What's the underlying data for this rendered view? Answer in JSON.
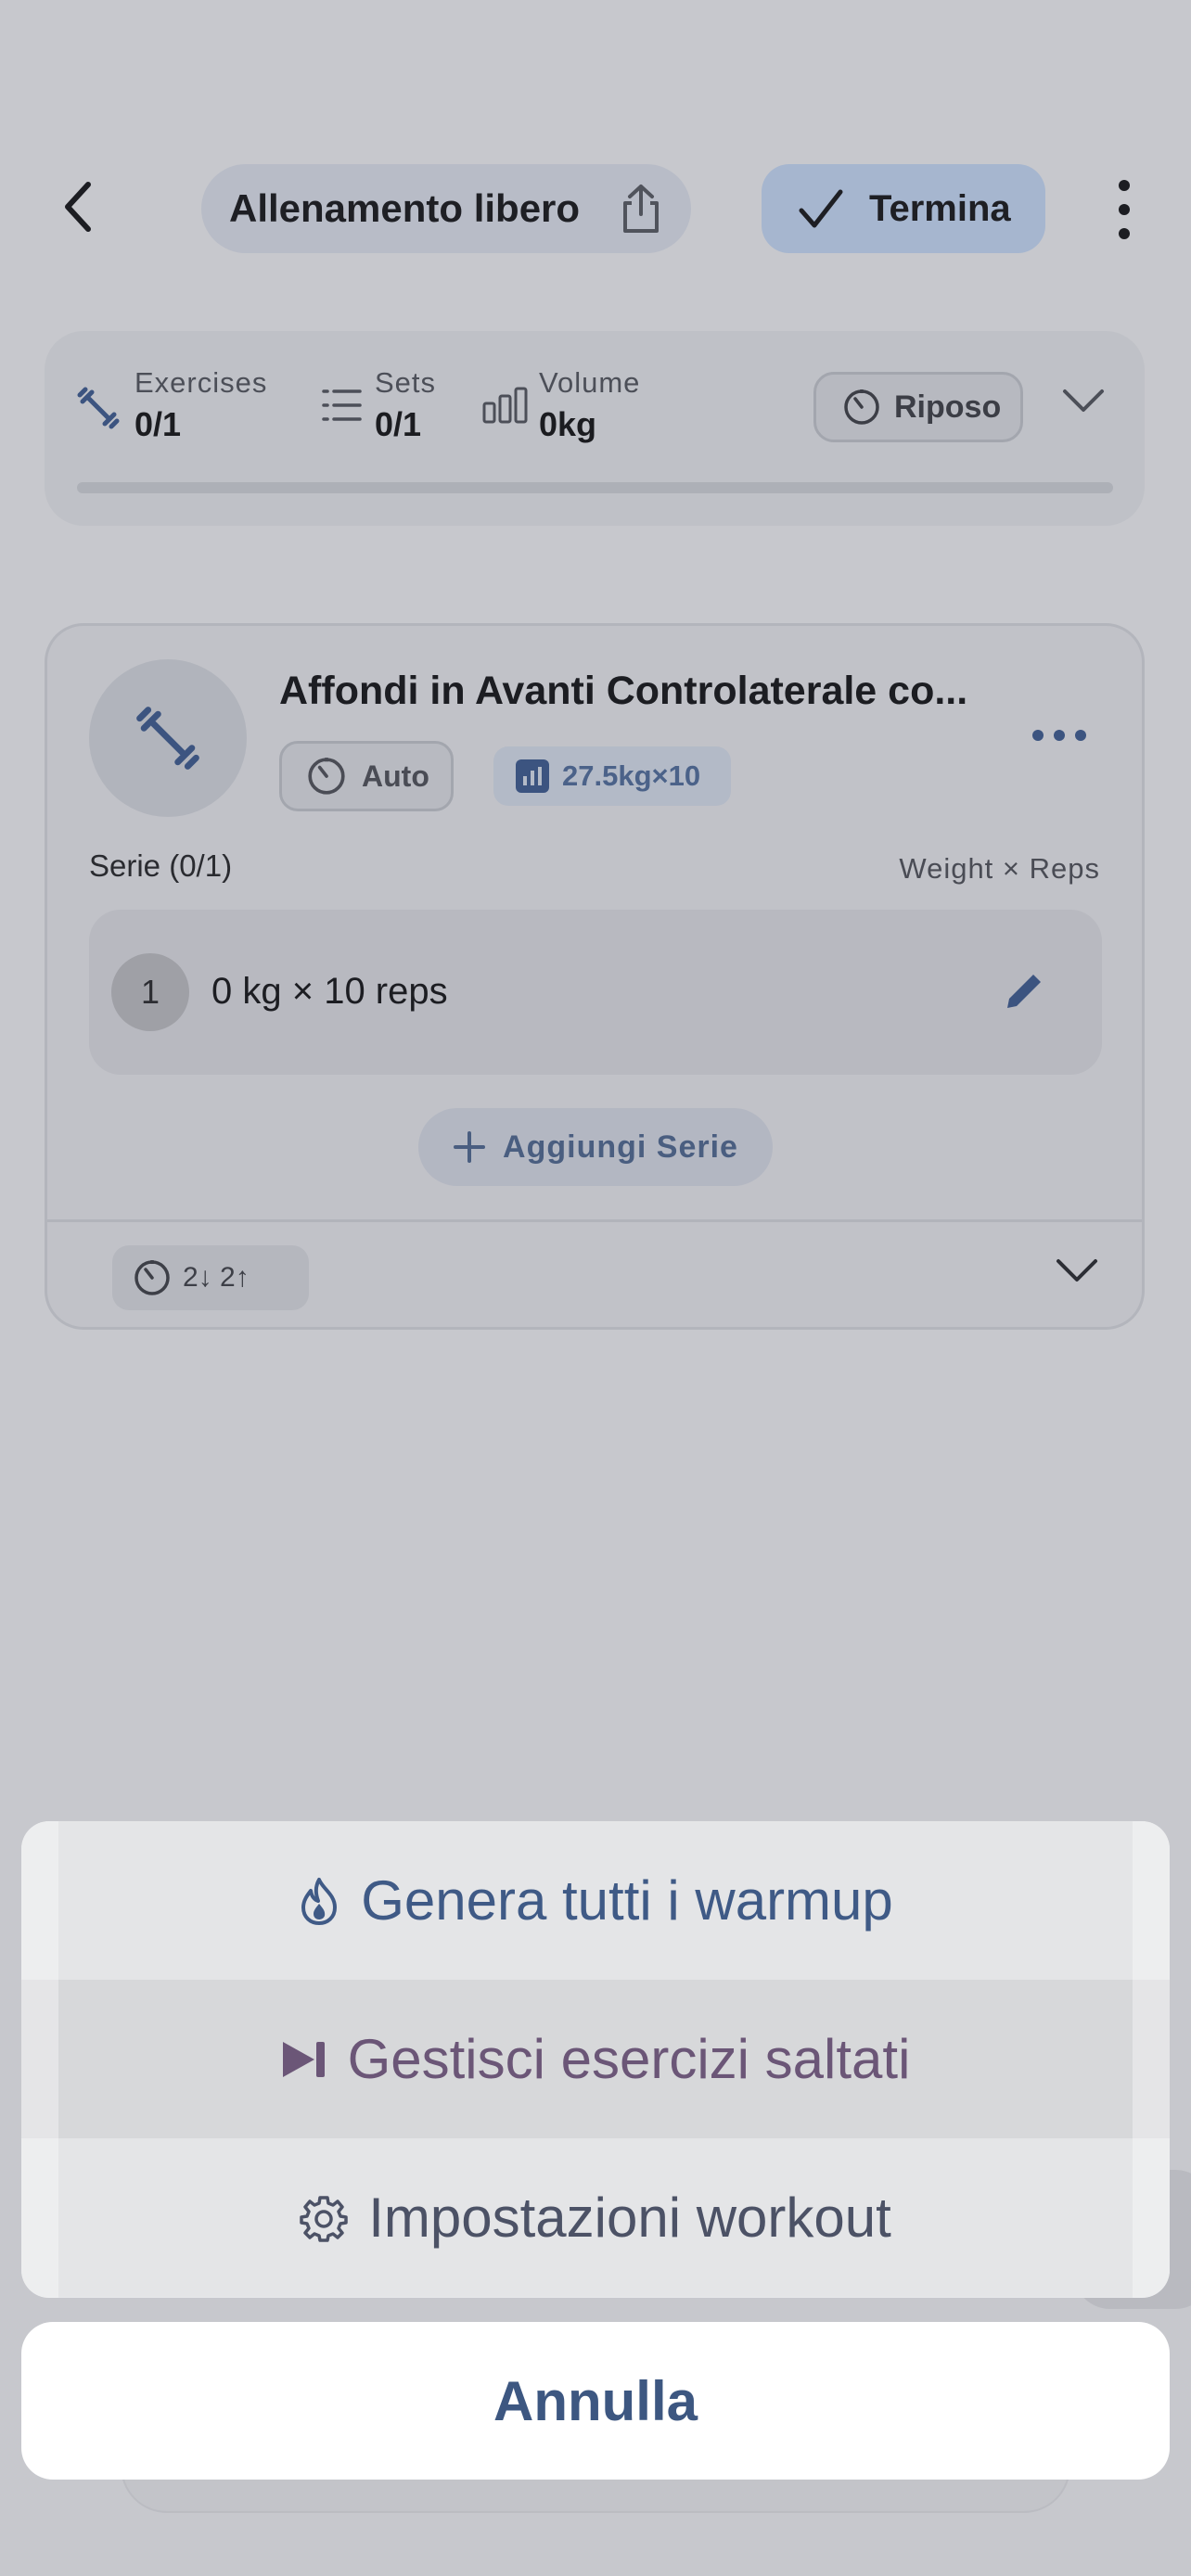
{
  "header": {
    "title": "Allenamento libero",
    "finish_label": "Termina"
  },
  "stats": {
    "exercises": {
      "label": "Exercises",
      "value": "0/1"
    },
    "sets": {
      "label": "Sets",
      "value": "0/1"
    },
    "volume": {
      "label": "Volume",
      "value": "0kg"
    },
    "rest_label": "Riposo",
    "progress": 0
  },
  "exercise": {
    "name": "Affondi in Avanti Controlaterale co...",
    "timer_chip": "Auto",
    "previous_chip": "27.5kg×10",
    "series_label": "Serie (0/1)",
    "columns_label": "Weight × Reps",
    "sets": [
      {
        "number": "1",
        "text": "0 kg × 10 reps"
      }
    ],
    "add_set_label": "Aggiungi Serie",
    "rest_summary": "2↓ 2↑"
  },
  "action_sheet": {
    "items": [
      {
        "label": "Genera tutti i warmup",
        "icon": "flame-icon",
        "color": "#3f5a86"
      },
      {
        "label": "Gestisci esercizi saltati",
        "icon": "skip-forward-icon",
        "color": "#6b5677"
      },
      {
        "label": "Impostazioni workout",
        "icon": "gear-icon",
        "color": "#4c5266"
      }
    ],
    "cancel_label": "Annulla"
  },
  "colors": {
    "accent_blue": "#3f5a86",
    "accent_purple": "#6b5677",
    "backdrop": "#c7c8cd"
  }
}
